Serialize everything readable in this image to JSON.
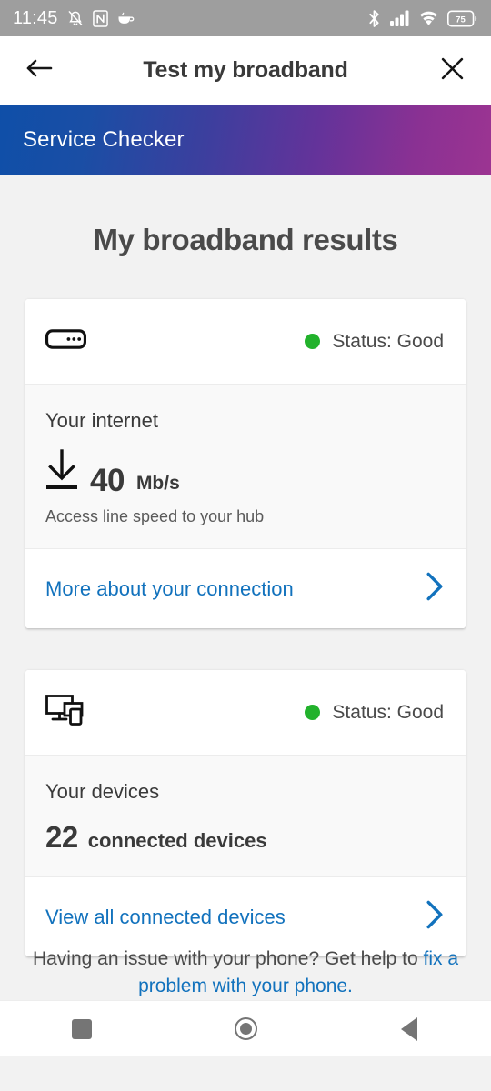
{
  "statusbar": {
    "time": "11:45",
    "left_icons": [
      "mute-vibrate-icon",
      "nfc-icon",
      "coffee-icon"
    ],
    "right_icons": [
      "bluetooth-icon",
      "cellular-signal-icon",
      "wifi-icon",
      "battery-icon"
    ],
    "battery_level": "75",
    "bar_color": "#9e9e9e"
  },
  "appbar": {
    "title": "Test my broadband",
    "back_icon": "back-arrow-icon",
    "close_icon": "close-icon"
  },
  "banner": {
    "title": "Service Checker",
    "gradient_start": "#0f4fa8",
    "gradient_end": "#9c3492"
  },
  "page": {
    "title": "My broadband results"
  },
  "cards": [
    {
      "icon": "router-icon",
      "status_label": "Status: Good",
      "status_color": "#22b22c",
      "body_label": "Your internet",
      "metric_icon": "download-arrow-icon",
      "metric_value": "40",
      "metric_unit": "Mb/s",
      "metric_sub": "Access line speed to your hub",
      "link_text": "More about your connection",
      "link_icon": "chevron-right-icon",
      "link_color": "#1272bd"
    },
    {
      "icon": "devices-icon",
      "status_label": "Status: Good",
      "status_color": "#22b22c",
      "body_label": "Your devices",
      "count": "22",
      "count_label": "connected devices",
      "link_text": "View all connected devices",
      "link_icon": "chevron-right-icon",
      "link_color": "#1272bd"
    }
  ],
  "footer": {
    "text": "Having an issue with your phone? Get help to",
    "link_text": "fix a problem with your phone."
  },
  "navbar": {
    "recents": "recents-square-icon",
    "home": "home-circle-icon",
    "back": "back-triangle-icon"
  }
}
